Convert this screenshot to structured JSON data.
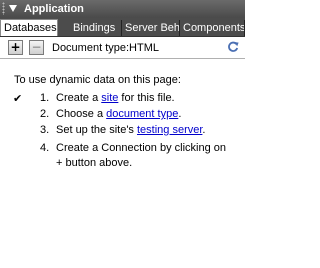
{
  "panel": {
    "title": "Application"
  },
  "tabs": [
    {
      "label": "Databases"
    },
    {
      "label": "Bindings"
    },
    {
      "label": "Server Behaviors"
    },
    {
      "label": "Components"
    }
  ],
  "toolbar": {
    "add_glyph": "+",
    "remove_glyph": "−",
    "doctype_label": "Document type:",
    "doctype_value": "HTML"
  },
  "content": {
    "intro": "To use dynamic data on this page:",
    "check_mark": "✔",
    "steps": [
      {
        "number": "1.",
        "before": "Create a ",
        "link": "site",
        "after": " for this file.",
        "done": true
      },
      {
        "number": "2.",
        "before": "Choose a ",
        "link": "document type",
        "after": ".",
        "done": false
      },
      {
        "number": "3.",
        "before": "Set up the site's ",
        "link": "testing server",
        "after": ".",
        "done": false
      },
      {
        "number": "4.",
        "line1": "Create a Connection by clicking on",
        "line2": "+ button above.",
        "done": false
      }
    ]
  },
  "colors": {
    "titlebar": "#5a5a5a",
    "tabbar": "#4c4c4c",
    "link": "#0000cc",
    "refresh": "#4a6fb3"
  }
}
